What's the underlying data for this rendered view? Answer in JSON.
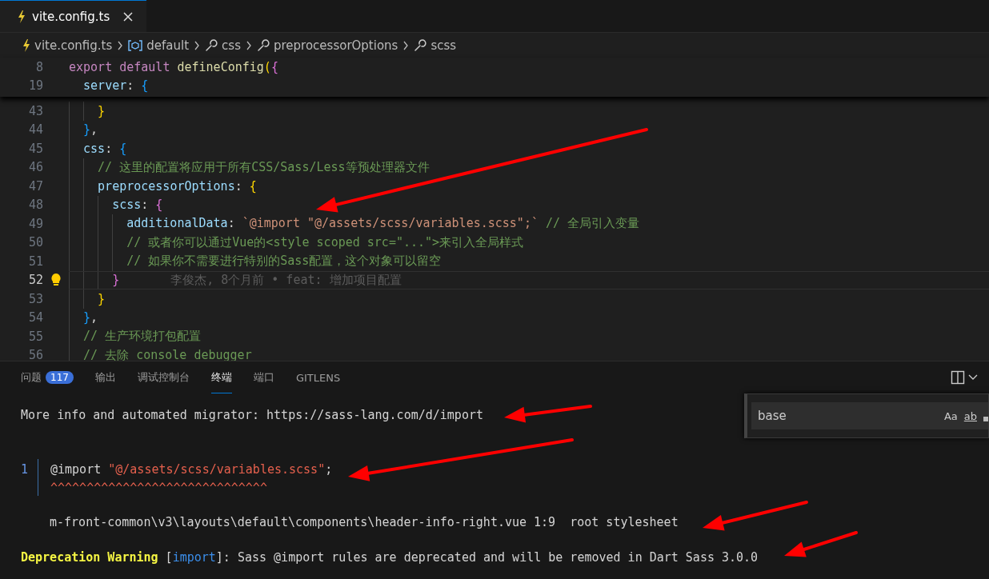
{
  "editor_tab": {
    "label": "vite.config.ts",
    "selected": true
  },
  "breadcrumbs": [
    {
      "label": "vite.config.ts",
      "kind": "file"
    },
    {
      "label": "default",
      "kind": "module"
    },
    {
      "label": "css",
      "kind": "property"
    },
    {
      "label": "preprocessorOptions",
      "kind": "property"
    },
    {
      "label": "scss",
      "kind": "property"
    }
  ],
  "sticky_lines": [
    {
      "number": "8",
      "segments": [
        {
          "text": "export ",
          "kind": "kw"
        },
        {
          "text": "default ",
          "kind": "kw"
        },
        {
          "text": "defineConfig",
          "kind": "fn"
        },
        {
          "text": "(",
          "kind": "b1"
        },
        {
          "text": "{",
          "kind": "b2"
        }
      ]
    },
    {
      "number": "19",
      "segments": [
        {
          "text": "  server",
          "kind": "prop"
        },
        {
          "text": ": ",
          "kind": "p"
        },
        {
          "text": "{",
          "kind": "b3"
        }
      ]
    }
  ],
  "lines": [
    {
      "number": "43",
      "current": false,
      "segments": [
        {
          "text": "    }",
          "kind": "b1"
        }
      ]
    },
    {
      "number": "44",
      "current": false,
      "segments": [
        {
          "text": "  }",
          "kind": "b3"
        },
        {
          "text": ",",
          "kind": "p"
        }
      ]
    },
    {
      "number": "45",
      "current": false,
      "segments": [
        {
          "text": "  css",
          "kind": "prop"
        },
        {
          "text": ": ",
          "kind": "p"
        },
        {
          "text": "{",
          "kind": "b3"
        }
      ]
    },
    {
      "number": "46",
      "current": false,
      "segments": [
        {
          "text": "    // 这里的配置将应用于所有CSS/Sass/Less等预处理器文件",
          "kind": "cm"
        }
      ]
    },
    {
      "number": "47",
      "current": false,
      "segments": [
        {
          "text": "    preprocessorOptions",
          "kind": "prop"
        },
        {
          "text": ": ",
          "kind": "p"
        },
        {
          "text": "{",
          "kind": "b1"
        }
      ]
    },
    {
      "number": "48",
      "current": false,
      "segments": [
        {
          "text": "      scss",
          "kind": "prop"
        },
        {
          "text": ": ",
          "kind": "p"
        },
        {
          "text": "{",
          "kind": "b2"
        }
      ]
    },
    {
      "number": "49",
      "current": false,
      "segments": [
        {
          "text": "        additionalData",
          "kind": "prop"
        },
        {
          "text": ": ",
          "kind": "p"
        },
        {
          "text": "`@import \"@/assets/scss/variables.scss\";`",
          "kind": "str"
        },
        {
          "text": " // 全局引入变量",
          "kind": "cm"
        }
      ]
    },
    {
      "number": "50",
      "current": false,
      "segments": [
        {
          "text": "        // 或者你可以通过Vue的<style scoped src=\"...\">来引入全局样式",
          "kind": "cm"
        }
      ]
    },
    {
      "number": "51",
      "current": false,
      "segments": [
        {
          "text": "        // 如果你不需要进行特别的Sass配置，这个对象可以留空",
          "kind": "cm"
        }
      ]
    },
    {
      "number": "52",
      "current": true,
      "blame": "李俊杰, 8个月前 • feat: 增加项目配置",
      "segments": [
        {
          "text": "      }",
          "kind": "b2"
        }
      ]
    },
    {
      "number": "53",
      "current": false,
      "segments": [
        {
          "text": "    }",
          "kind": "b1"
        }
      ]
    },
    {
      "number": "54",
      "current": false,
      "segments": [
        {
          "text": "  }",
          "kind": "b3"
        },
        {
          "text": ",",
          "kind": "p"
        }
      ]
    },
    {
      "number": "55",
      "current": false,
      "segments": [
        {
          "text": "  // 生产环境打包配置",
          "kind": "cm"
        }
      ]
    },
    {
      "number": "56",
      "current": false,
      "segments": [
        {
          "text": "  // 去除 console debugger",
          "kind": "cm"
        }
      ]
    }
  ],
  "panel_tabs": [
    {
      "label": "问题",
      "badge": "117",
      "selected": false
    },
    {
      "label": "输出",
      "selected": false
    },
    {
      "label": "调试控制台",
      "selected": false
    },
    {
      "label": "终端",
      "selected": true
    },
    {
      "label": "端口",
      "selected": false
    },
    {
      "label": "GITLENS",
      "selected": false
    }
  ],
  "find_widget": {
    "value": "base",
    "options": [
      "Aa",
      "ab"
    ]
  },
  "terminal": [
    {
      "kind": "text",
      "segments": [
        {
          "text": "More info and automated migrator: https://sass-lang.com/d/import",
          "kind": "p"
        }
      ]
    },
    {
      "kind": "source",
      "number": "1",
      "segments": [
        {
          "text": "@import ",
          "kind": "p"
        },
        {
          "text": "\"@/assets/scss/variables.scss\"",
          "kind": "err"
        },
        {
          "text": ";",
          "kind": "p"
        }
      ]
    },
    {
      "kind": "carets",
      "segments": [
        {
          "text": "^^^^^^^^^^^^^^^^^^^^^^^^^^^^^^",
          "kind": "err"
        }
      ]
    },
    {
      "kind": "location",
      "segments": [
        {
          "text": "m-front-common\\v3\\layouts\\default\\components\\header-info-right.vue 1:9  root stylesheet",
          "kind": "p"
        }
      ]
    },
    {
      "kind": "warning",
      "segments": [
        {
          "text": "Deprecation Warning",
          "kind": "warn"
        },
        {
          "text": " [",
          "kind": "p"
        },
        {
          "text": "import",
          "kind": "tag"
        },
        {
          "text": "]: Sass @import rules are deprecated and will be removed in Dart Sass 3.0.0",
          "kind": "p"
        }
      ]
    }
  ]
}
